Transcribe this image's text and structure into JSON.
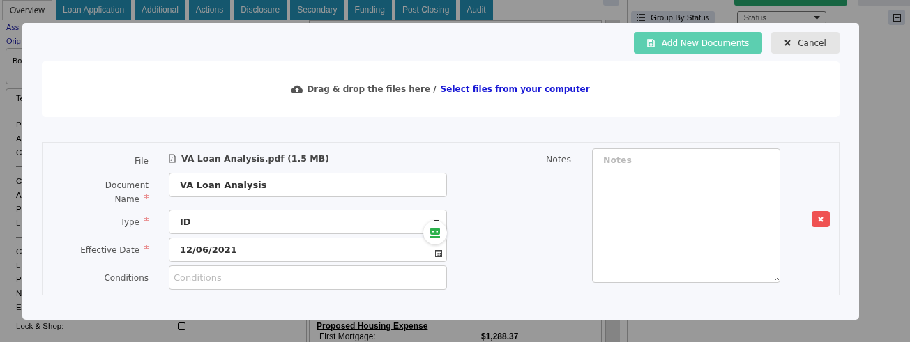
{
  "tabs": [
    {
      "label": "Overview",
      "selected": true
    },
    {
      "label": "Loan Application",
      "selected": false
    },
    {
      "label": "Additional",
      "selected": false
    },
    {
      "label": "Actions",
      "selected": false
    },
    {
      "label": "Disclosure",
      "selected": false
    },
    {
      "label": "Secondary",
      "selected": false
    },
    {
      "label": "Funding",
      "selected": false
    },
    {
      "label": "Post Closing",
      "selected": false
    },
    {
      "label": "Audit",
      "selected": false
    }
  ],
  "left_panel": {
    "links": [
      "Assi",
      "Orig"
    ],
    "box_titles": [
      "Bo",
      "Te"
    ],
    "groups": [
      [
        {
          "label": "P"
        },
        {
          "label": "A"
        },
        {
          "label": "C"
        }
      ],
      [
        {
          "label": "C"
        },
        {
          "label": "A"
        },
        {
          "label": "P"
        },
        {
          "label": "L"
        }
      ],
      [
        {
          "label": "C"
        },
        {
          "label": "L"
        },
        {
          "label": "P"
        },
        {
          "label": "N"
        },
        {
          "label": "E"
        },
        {
          "label": "Lock & Shop:",
          "checked": false
        }
      ]
    ]
  },
  "middle_panel": {
    "heading": "Proposed Housing Expense",
    "rows": [
      {
        "label": "First Mortgage:",
        "value": "$1,288.37"
      }
    ]
  },
  "right_panel": {
    "group_button": "Group By Status",
    "status_select": {
      "placeholder": "Status"
    }
  },
  "modal": {
    "buttons": [
      {
        "label": "Add New Documents",
        "kind": "primary"
      },
      {
        "label": "Cancel",
        "kind": "secondary"
      }
    ],
    "dropzone": {
      "text": "Drag & drop the files here /",
      "link": "Select files from your computer"
    },
    "documents": [
      {
        "fields": [
          {
            "label": "File",
            "kind": "file",
            "required": false,
            "value": "VA Loan Analysis.pdf (1.5 MB)"
          },
          {
            "label": "Document Name",
            "kind": "text",
            "required": true,
            "value": "VA Loan Analysis"
          },
          {
            "label": "Type",
            "kind": "select",
            "required": true,
            "value": "ID"
          },
          {
            "label": "Effective Date",
            "kind": "date",
            "required": true,
            "value": "12/06/2021"
          },
          {
            "label": "Conditions",
            "kind": "text",
            "required": false,
            "placeholder": "Conditions"
          }
        ],
        "notes": {
          "label": "Notes",
          "placeholder": "Notes"
        }
      }
    ]
  }
}
